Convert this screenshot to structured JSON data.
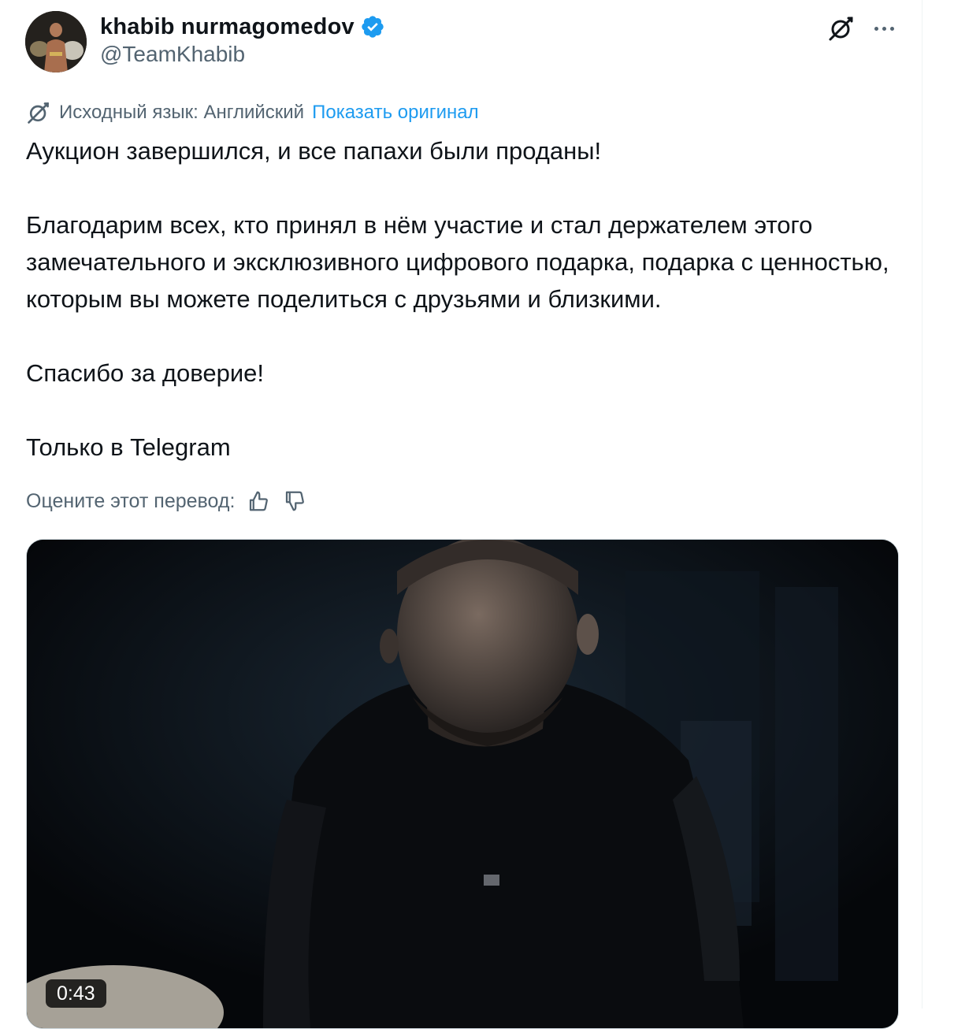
{
  "author": {
    "display_name": "khabib nurmagomedov",
    "handle": "@TeamKhabib",
    "verified": true,
    "verified_badge_color": "#1d9bf0",
    "avatar_icon": "avatar-photo"
  },
  "header_actions": {
    "grok_icon": "grok-icon",
    "more_icon": "more-dots-icon"
  },
  "translation": {
    "icon": "translate-icon",
    "source_label": "Исходный язык: Английский",
    "show_original_label": "Показать оригинал",
    "link_color": "#1d9bf0"
  },
  "tweet": {
    "paragraphs": [
      "Аукцион завершился, и все папахи были проданы!",
      "Благодарим всех, кто принял в нём участие и стал держателем этого замечательного и эксклюзивного цифрового подарка, подарка с ценностью, которым вы можете поделиться с друзьями и близкими.",
      "Спасибо за доверие!",
      "Только в Telegram"
    ]
  },
  "rate_translation": {
    "label": "Оцените этот перевод:",
    "like_icon": "thumbs-up-icon",
    "dislike_icon": "thumbs-down-icon"
  },
  "media": {
    "type": "video",
    "duration": "0:43"
  }
}
